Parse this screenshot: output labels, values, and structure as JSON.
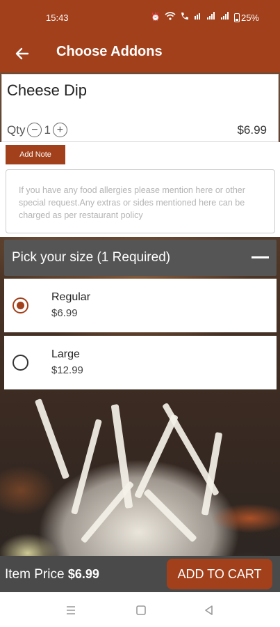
{
  "status_bar": {
    "time": "15:43",
    "battery": "25%",
    "icons": [
      "alarm-icon",
      "wifi-icon",
      "wifi-calling-icon",
      "volte-icon",
      "signal-icon",
      "signal-icon",
      "battery-icon"
    ]
  },
  "app_bar": {
    "title": "Choose Addons",
    "back_icon": "arrow-left-icon"
  },
  "item": {
    "name": "Cheese Dip",
    "qty_label": "Qty",
    "qty": "1",
    "price": "$6.99"
  },
  "note": {
    "button_label": "Add Note",
    "placeholder": "If you have any food allergies please mention here or other special request.Any extras or sides mentioned here can be charged as per restaurant policy"
  },
  "size_group": {
    "title": "Pick your size (1 Required)",
    "options": [
      {
        "name": "Regular",
        "price": "$6.99",
        "selected": true
      },
      {
        "name": "Large",
        "price": "$12.99",
        "selected": false
      }
    ]
  },
  "footer": {
    "price_label": "Item Price",
    "price_value": "$6.99",
    "add_to_cart": "ADD TO CART"
  },
  "colors": {
    "brand": "#a2401b",
    "header_gray": "#555555",
    "footer_gray": "#4a4a4a"
  }
}
